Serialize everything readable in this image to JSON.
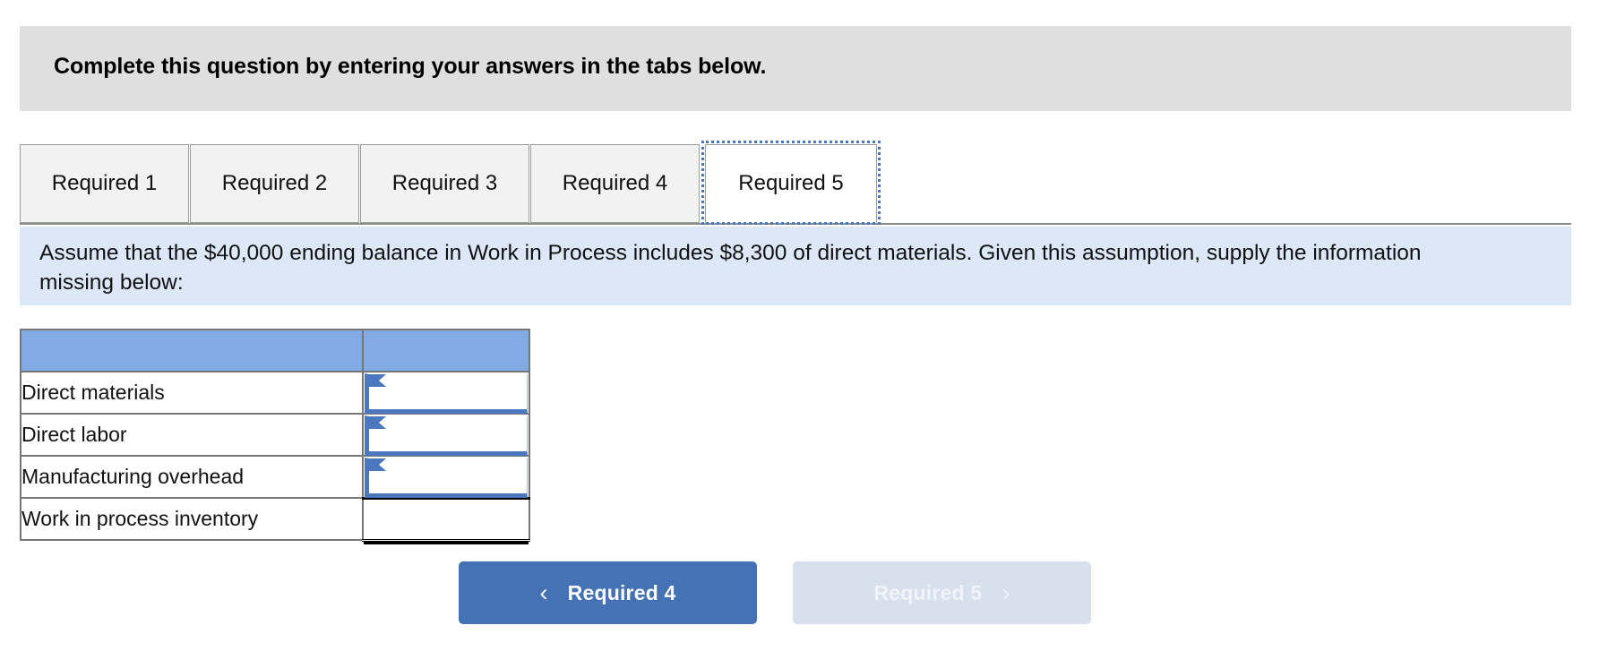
{
  "header": {
    "title": "Complete this question by entering your answers in the tabs below."
  },
  "tabs": [
    {
      "label": "Required 1",
      "selected": false
    },
    {
      "label": "Required 2",
      "selected": false
    },
    {
      "label": "Required 3",
      "selected": false
    },
    {
      "label": "Required 4",
      "selected": false
    },
    {
      "label": "Required 5",
      "selected": true
    }
  ],
  "instruction": {
    "text": "Assume that the $40,000 ending balance in Work in Process includes $8,300 of direct materials. Given this assumption, supply the information missing below:"
  },
  "table": {
    "header": {
      "label_col": "",
      "value_col": ""
    },
    "rows": [
      {
        "label": "Direct materials",
        "value": "",
        "type": "input"
      },
      {
        "label": "Direct labor",
        "value": "",
        "type": "input"
      },
      {
        "label": "Manufacturing overhead",
        "value": "",
        "type": "input"
      },
      {
        "label": "Work in process inventory",
        "value": "",
        "type": "total"
      }
    ]
  },
  "nav": {
    "prev_label": "Required 4",
    "next_label": "Required 5",
    "prev_icon": "chevron-left-icon",
    "next_icon": "chevron-right-icon",
    "prev_chevron": "‹",
    "next_chevron": "›"
  },
  "colors": {
    "header_banner_bg": "#dfdfdf",
    "instruction_bg": "#dce8f8",
    "table_header_bg": "#81abe2",
    "input_accent": "#4a77bd",
    "nav_prev_bg": "#4472b4",
    "nav_next_bg": "#d8e0ed",
    "tab_bg": "#f2f2f2",
    "tab_selected_bg": "#ffffff"
  }
}
